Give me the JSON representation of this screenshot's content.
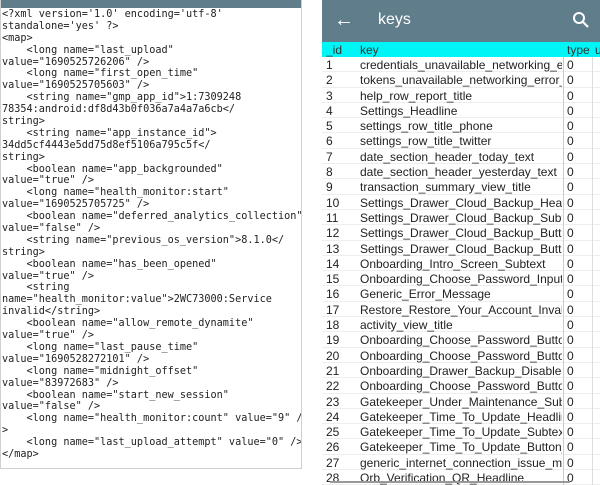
{
  "xml_viewer": {
    "lines": [
      "<?xml version='1.0' encoding='utf-8'",
      "standalone='yes' ?>",
      "<map>",
      "    <long name=\"last_upload\"",
      "value=\"1690525726206\" />",
      "    <long name=\"first_open_time\"",
      "value=\"1690525705603\" />",
      "    <string name=\"gmp_app_id\">1:7309248",
      "78354:android:df8d43b0f036a7a4a7a6cb</",
      "string>",
      "    <string name=\"app_instance_id\">",
      "34dd5cf4443e5dd75d8ef5106a795c5f</",
      "string>",
      "    <boolean name=\"app_backgrounded\"",
      "value=\"true\" />",
      "    <long name=\"health_monitor:start\"",
      "value=\"1690525705725\" />",
      "    <boolean name=\"deferred_analytics_collection\"",
      "value=\"false\" />",
      "    <string name=\"previous_os_version\">8.1.0</",
      "string>",
      "    <boolean name=\"has_been_opened\"",
      "value=\"true\" />",
      "    <string",
      "name=\"health_monitor:value\">2WC73000:Service",
      "invalid</string>",
      "    <boolean name=\"allow_remote_dynamite\"",
      "value=\"true\" />",
      "    <long name=\"last_pause_time\"",
      "value=\"1690528272101\" />",
      "    <long name=\"midnight_offset\"",
      "value=\"83972683\" />",
      "    <boolean name=\"start_new_session\"",
      "value=\"false\" />",
      "    <long name=\"health_monitor:count\" value=\"9\" /",
      ">",
      "    <long name=\"last_upload_attempt\" value=\"0\" />",
      "</map>"
    ]
  },
  "table_app": {
    "title": "keys",
    "back_icon": "arrow-left-icon",
    "search_icon": "search-icon",
    "columns": [
      "_id",
      "key",
      "type",
      "u"
    ],
    "rows": [
      [
        "1",
        "credentials_unavailable_networking_error",
        "0"
      ],
      [
        "2",
        "tokens_unavailable_networking_error_des",
        "0"
      ],
      [
        "3",
        "help_row_report_title",
        "0"
      ],
      [
        "4",
        "Settings_Headline",
        "0"
      ],
      [
        "5",
        "settings_row_title_phone",
        "0"
      ],
      [
        "6",
        "settings_row_title_twitter",
        "0"
      ],
      [
        "7",
        "date_section_header_today_text",
        "0"
      ],
      [
        "8",
        "date_section_header_yesterday_text",
        "0"
      ],
      [
        "9",
        "transaction_summary_view_title",
        "0"
      ],
      [
        "10",
        "Settings_Drawer_Cloud_Backup_Heading",
        "0"
      ],
      [
        "11",
        "Settings_Drawer_Cloud_Backup_Subtext",
        "0"
      ],
      [
        "12",
        "Settings_Drawer_Cloud_Backup_Button_C",
        "0"
      ],
      [
        "13",
        "Settings_Drawer_Cloud_Backup_Button_D",
        "0"
      ],
      [
        "14",
        "Onboarding_Intro_Screen_Subtext",
        "0"
      ],
      [
        "15",
        "Onboarding_Choose_Password_Input_Pa",
        "0"
      ],
      [
        "16",
        "Generic_Error_Message",
        "0"
      ],
      [
        "17",
        "Restore_Restore_Your_Account_Invalid_P",
        "0"
      ],
      [
        "18",
        "activity_view_title",
        "0"
      ],
      [
        "19",
        "Onboarding_Choose_Password_Button_N",
        "0"
      ],
      [
        "20",
        "Onboarding_Choose_Password_Button_F",
        "0"
      ],
      [
        "21",
        "Onboarding_Drawer_Backup_Disabled_He",
        "0"
      ],
      [
        "22",
        "Onboarding_Choose_Password_Button_S",
        "0"
      ],
      [
        "23",
        "Gatekeeper_Under_Maintenance_Subtext",
        "0"
      ],
      [
        "24",
        "Gatekeeper_Time_To_Update_Headline",
        "0"
      ],
      [
        "25",
        "Gatekeeper_Time_To_Update_Subtext",
        "0"
      ],
      [
        "26",
        "Gatekeeper_Time_To_Update_Button_Ret",
        "0"
      ],
      [
        "27",
        "generic_internet_connection_issue_mess",
        "0"
      ],
      [
        "28",
        "Orb_Verification_QR_Headline",
        "0"
      ]
    ]
  }
}
